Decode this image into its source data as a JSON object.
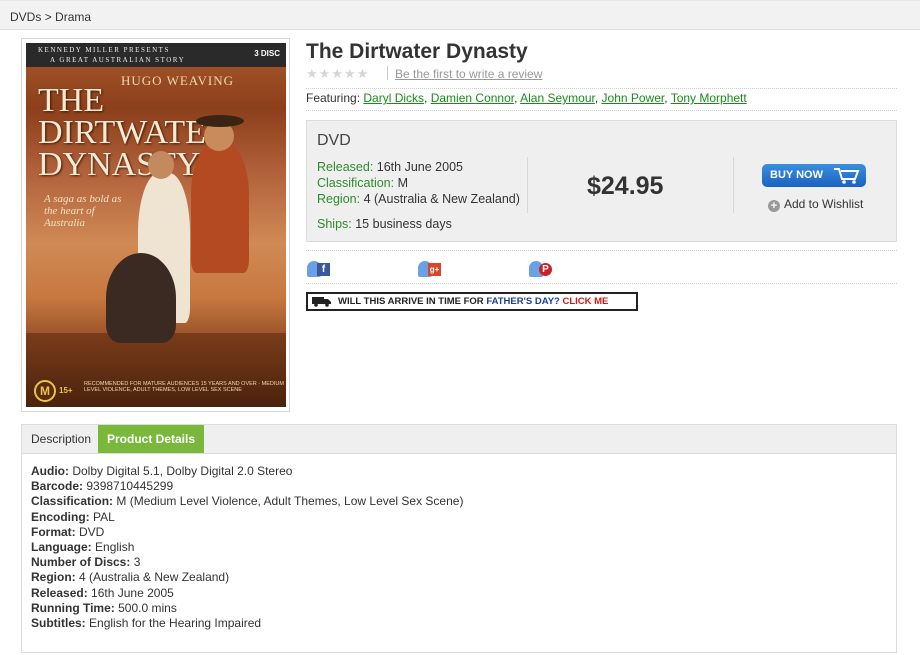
{
  "breadcrumb": {
    "category": "DVDs",
    "separator": ">",
    "subcategory": "Drama"
  },
  "cover": {
    "top_line1": "KENNEDY MILLER PRESENTS",
    "top_line2": "A GREAT AUSTRALIAN STORY",
    "disc_count": "3 DISC",
    "actor": "HUGO WEAVING",
    "title_line1": "THE DIRTWATER",
    "title_line2": "DYNASTY",
    "tagline": "A saga as bold as the heart of Australia",
    "rating": "M",
    "rating_age": "15+",
    "advice": "RECOMMENDED FOR MATURE AUDIENCES 15 YEARS AND OVER · MEDIUM LEVEL VIOLENCE, ADULT THEMES, LOW LEVEL SEX SCENE"
  },
  "product": {
    "title": "The Dirtwater Dynasty",
    "stars_filled": 0,
    "stars_total": 5,
    "review_prompt": "Be the first to write a review",
    "featuring_label": "Featuring:",
    "actors": [
      "Daryl Dicks",
      "Damien Connor",
      "Alan Seymour",
      "John Power",
      "Tony Morphett"
    ]
  },
  "purchase": {
    "format": "DVD",
    "released_label": "Released:",
    "released": "16th June 2005",
    "classification_label": "Classification:",
    "classification": "M",
    "region_label": "Region:",
    "region": "4 (Australia & New Zealand)",
    "ships_label": "Ships:",
    "ships": "15 business days",
    "price": "$24.95",
    "buy_label": "BUY NOW",
    "wishlist_label": "Add to Wishlist"
  },
  "share": {
    "facebook": "f",
    "googleplus": "g+",
    "pinterest": "P"
  },
  "promo": {
    "part1": "WILL THIS ARRIVE IN TIME FOR",
    "part2": "FATHER'S DAY?",
    "cta": "CLICK ME"
  },
  "tabs": {
    "description": "Description",
    "details": "Product Details"
  },
  "details": [
    {
      "key": "Audio:",
      "value": "Dolby Digital 5.1, Dolby Digital 2.0 Stereo"
    },
    {
      "key": "Barcode:",
      "value": "9398710445299"
    },
    {
      "key": "Classification:",
      "value": "M (Medium Level Violence, Adult Themes, Low Level Sex Scene)"
    },
    {
      "key": "Encoding:",
      "value": "PAL"
    },
    {
      "key": "Format:",
      "value": "DVD"
    },
    {
      "key": "Language:",
      "value": "English"
    },
    {
      "key": "Number of Discs:",
      "value": "3"
    },
    {
      "key": "Region:",
      "value": "4 (Australia & New Zealand)"
    },
    {
      "key": "Released:",
      "value": "16th June 2005"
    },
    {
      "key": "Running Time:",
      "value": "500.0 mins"
    },
    {
      "key": "Subtitles:",
      "value": "English for the Hearing Impaired"
    }
  ],
  "colors": {
    "accent_green": "#79b83a",
    "link_green": "#1a8a1a",
    "label_green": "#2e8b2e",
    "buy_blue": "#1a62c0",
    "promo_red": "#d01818"
  }
}
